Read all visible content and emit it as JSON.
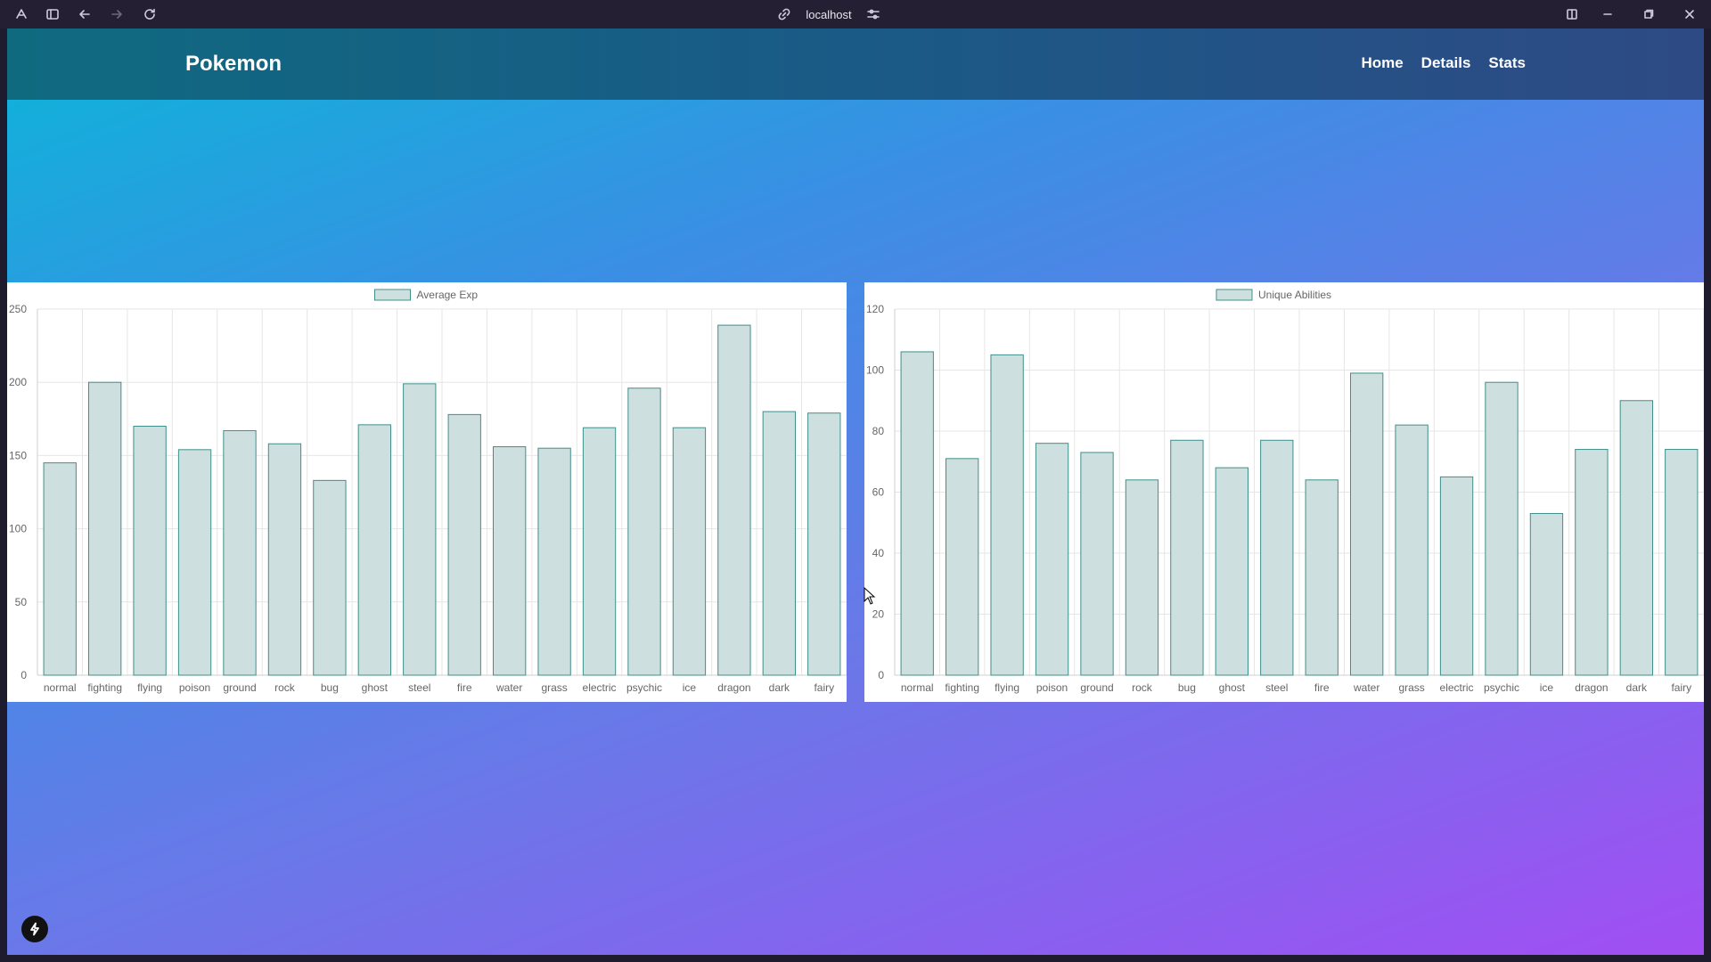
{
  "browser": {
    "url": "localhost"
  },
  "navbar": {
    "brand": "Pokemon",
    "links": [
      "Home",
      "Details",
      "Stats"
    ]
  },
  "chart_data": [
    {
      "type": "bar",
      "legend": "Average Exp",
      "categories": [
        "normal",
        "fighting",
        "flying",
        "poison",
        "ground",
        "rock",
        "bug",
        "ghost",
        "steel",
        "fire",
        "water",
        "grass",
        "electric",
        "psychic",
        "ice",
        "dragon",
        "dark",
        "fairy"
      ],
      "values": [
        145,
        200,
        170,
        154,
        167,
        158,
        133,
        171,
        199,
        178,
        156,
        155,
        169,
        196,
        169,
        239,
        180,
        179
      ],
      "ylim": [
        0,
        250
      ],
      "yticks": [
        0,
        50,
        100,
        150,
        200,
        250
      ],
      "bar_fill": "#cde0df",
      "bar_stroke": "#3f8f8a",
      "grid": true,
      "legend_position": "top-center"
    },
    {
      "type": "bar",
      "legend": "Unique Abilities",
      "categories": [
        "normal",
        "fighting",
        "flying",
        "poison",
        "ground",
        "rock",
        "bug",
        "ghost",
        "steel",
        "fire",
        "water",
        "grass",
        "electric",
        "psychic",
        "ice",
        "dragon",
        "dark",
        "fairy"
      ],
      "values": [
        106,
        71,
        105,
        76,
        73,
        64,
        77,
        68,
        77,
        64,
        99,
        82,
        65,
        96,
        53,
        74,
        90,
        74
      ],
      "ylim": [
        0,
        120
      ],
      "yticks": [
        0,
        20,
        40,
        60,
        80,
        100,
        120
      ],
      "bar_fill": "#cde0df",
      "bar_stroke": "#3f8f8a",
      "grid": true,
      "legend_position": "top-center"
    }
  ],
  "icons": {
    "fab": "lightning-icon"
  }
}
